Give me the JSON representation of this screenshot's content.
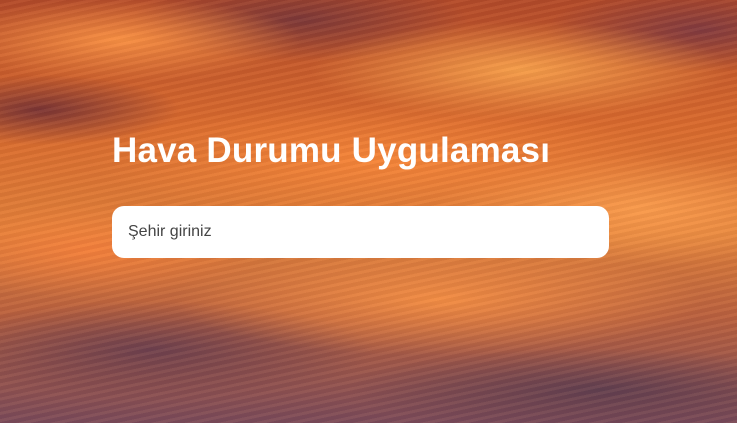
{
  "app": {
    "title": "Hava Durumu Uygulaması"
  },
  "search": {
    "placeholder": "Şehir giriniz",
    "value": ""
  }
}
